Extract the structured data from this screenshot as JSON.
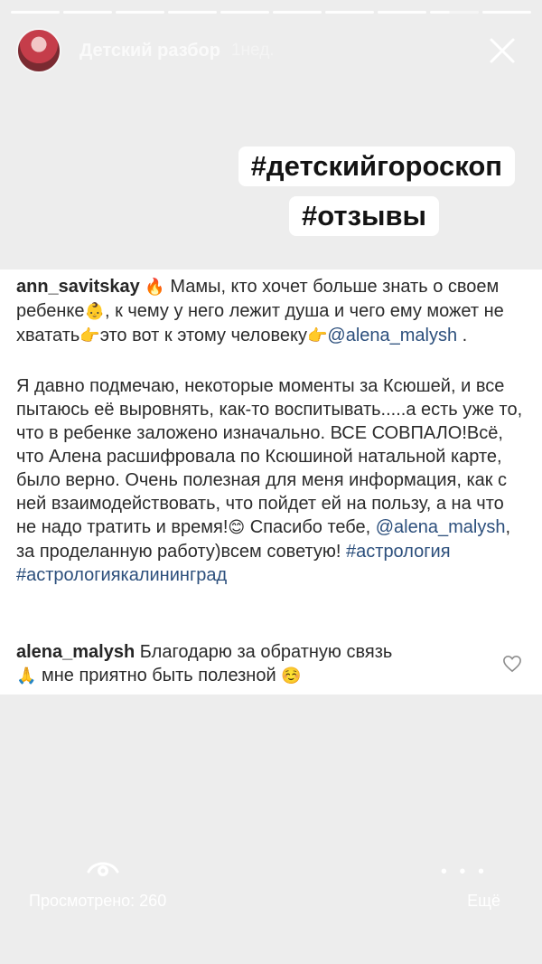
{
  "story": {
    "segments": 10,
    "current_segment": 9
  },
  "header": {
    "username": "Детский разбор",
    "time_ago": "1нед.",
    "avatar_icon": "avatar-icon",
    "close_icon": "close-icon"
  },
  "tags": {
    "line1": "#детскийгороскоп",
    "line2": "#отзывы"
  },
  "comments": [
    {
      "username": "ann_savitskay",
      "text_parts": [
        "🔥",
        "Мамы, кто хочет больше знать о своем ребенке",
        "👶",
        ", к чему у него лежит душа и чего ему может не хватать",
        "👉",
        "это вот к этому человеку",
        "👉",
        "@alena_malysh",
        " ."
      ]
    },
    {
      "text_parts": [
        "Я давно подмечаю, некоторые моменты за Ксюшей, и все пытаюсь её выровнять, как-то воспитывать.....а есть уже то, что в ребенке заложено изначально. ВСЕ СОВПАЛО!Всё, что Алена расшифровала по Ксюшиной натальной карте, было верно. Очень полезная для меня информация, как с ней взаимодействовать, что пойдет ей на пользу, а на что не надо тратить и время!",
        "😊",
        " Спасибо тебе, ",
        "@alena_malysh",
        ", за проделанную работу)всем советую! ",
        "#астрология",
        " ",
        "#астрологиякалининград"
      ]
    },
    {
      "username": "alena_malysh",
      "text_parts": [
        "Благодарю за обратную связь",
        "🙏",
        " мне приятно быть полезной ",
        "☺️"
      ]
    }
  ],
  "footer": {
    "views_label": "Просмотрено: 260",
    "more_label": "Ещё",
    "eye_icon": "eye-icon",
    "more_dots": "• • •"
  }
}
